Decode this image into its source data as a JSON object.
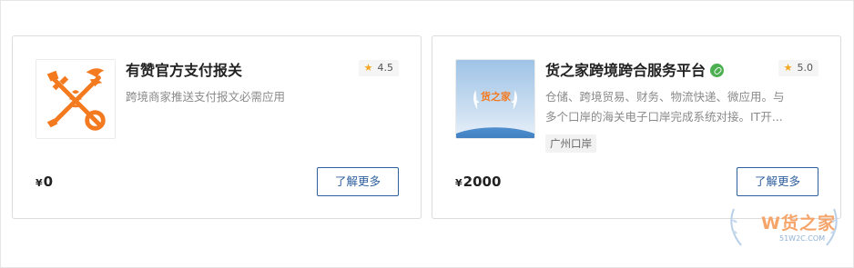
{
  "cards": [
    {
      "title": "有赞官方支付报关",
      "rating": "4.5",
      "description": "跨境商家推送支付报文必需应用",
      "price_currency": "¥",
      "price": "0",
      "button_label": "了解更多"
    },
    {
      "title": "货之家跨境跨合服务平台",
      "rating": "5.0",
      "logo_text": "货之家",
      "description_line1": "仓储、跨境贸易、财务、物流快递、微应用。与",
      "description_line2": "多个口岸的海关电子口岸完成系统对接。IT开...",
      "tag": "广州口岸",
      "price_currency": "¥",
      "price": "2000",
      "button_label": "了解更多"
    }
  ],
  "watermark": {
    "text": "W货之家",
    "sub": "51W2C.COM"
  },
  "colors": {
    "accent": "#2f5f9e",
    "star": "#f5a623",
    "verified": "#4caf50",
    "logo_orange": "#f47a20"
  },
  "icons": [
    "customs-key-logo",
    "star-icon",
    "verified-icon",
    "laurel-logo"
  ]
}
